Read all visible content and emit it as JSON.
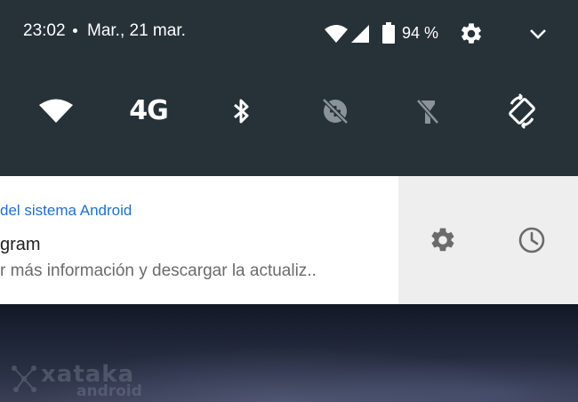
{
  "status_bar": {
    "time": "23:02",
    "date": "Mar., 21 mar.",
    "battery_percent": "94 %",
    "battery_level": 0.94,
    "icons": [
      "wifi-icon",
      "cell-signal-icon",
      "battery-icon",
      "settings-gear-icon",
      "chevron-down-icon"
    ]
  },
  "quick_settings": {
    "tiles": [
      {
        "icon": "wifi-icon",
        "active": true
      },
      {
        "label": "4G",
        "active": true
      },
      {
        "icon": "bluetooth-icon",
        "active": true
      },
      {
        "icon": "data-saver-off-icon",
        "active": false
      },
      {
        "icon": "flashlight-off-icon",
        "active": false
      },
      {
        "icon": "auto-rotate-icon",
        "active": true
      }
    ]
  },
  "notification": {
    "app_name": "del sistema Android",
    "title": "gram",
    "text": "r más información y descargar la actualiz..",
    "actions": [
      "settings-gear-icon",
      "snooze-clock-icon"
    ]
  },
  "watermark": {
    "line1": "xataka",
    "line2": "android"
  },
  "colors": {
    "panel": "#263238",
    "accent_blue": "#1f6fd1",
    "icon_active": "#ffffff",
    "icon_inactive": "#8a9398",
    "actions_bg": "#eeeeee",
    "action_icon": "#6b6b6b"
  }
}
